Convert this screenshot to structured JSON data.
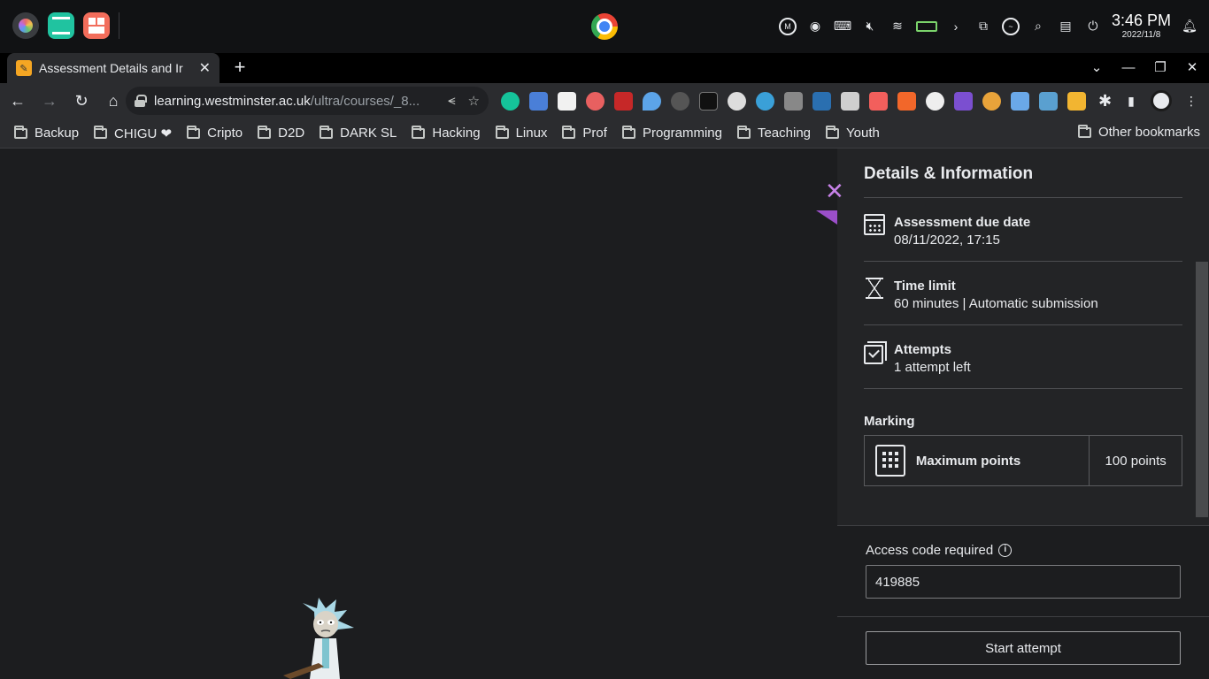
{
  "os": {
    "time": "3:46 PM",
    "date": "2022/11/8"
  },
  "tab": {
    "title": "Assessment Details and Ir",
    "close_glyph": "✕"
  },
  "toolbar": {
    "url_host": "learning.westminster.ac.uk",
    "url_path": "/ultra/courses/_8..."
  },
  "bookmarks": {
    "items": [
      "Backup",
      "CHIGU ❤",
      "Cripto",
      "D2D",
      "DARK SL",
      "Hacking",
      "Linux",
      "Prof",
      "Programming",
      "Teaching",
      "Youth"
    ],
    "other": "Other bookmarks"
  },
  "panel": {
    "title": "Details & Information",
    "close_glyph": "✕",
    "due": {
      "label": "Assessment due date",
      "value": "08/11/2022, 17:15"
    },
    "time_limit": {
      "label": "Time limit",
      "value": "60 minutes | Automatic submission"
    },
    "attempts": {
      "label": "Attempts",
      "value": "1 attempt left"
    },
    "marking": {
      "heading": "Marking",
      "label": "Maximum points",
      "value": "100 points"
    },
    "access": {
      "label": "Access code required",
      "info_glyph": "i",
      "value": "419885"
    },
    "start_button": "Start attempt"
  },
  "colors": {
    "accent_purple": "#c782e8",
    "flag_purple": "#9b4fc9",
    "page_bg": "#1c1d1f",
    "panel_bg": "#232426"
  }
}
